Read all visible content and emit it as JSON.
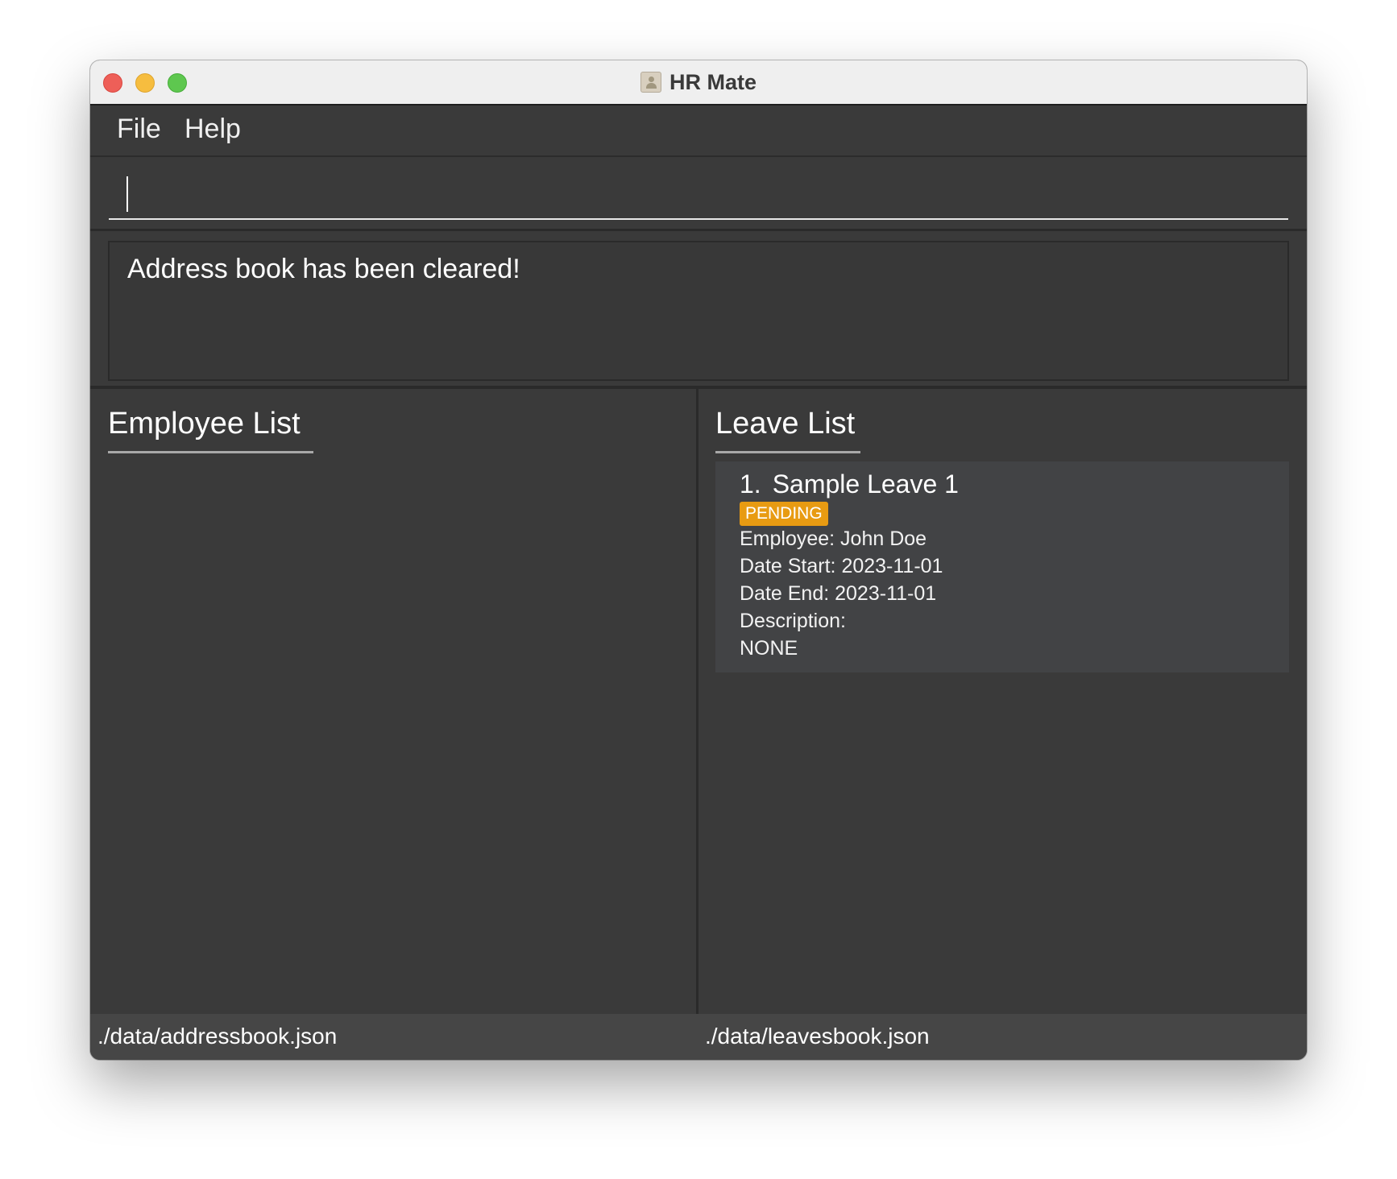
{
  "window": {
    "title": "HR Mate"
  },
  "menu": {
    "file": "File",
    "help": "Help"
  },
  "command": {
    "value": "",
    "placeholder": ""
  },
  "result": {
    "message": "Address book has been cleared!"
  },
  "employee_list": {
    "title": "Employee List",
    "items": []
  },
  "leave_list": {
    "title": "Leave List",
    "items": [
      {
        "index": "1.",
        "title": "Sample Leave 1",
        "status": "PENDING",
        "employee": "Employee: John Doe",
        "date_start": "Date Start: 2023-11-01",
        "date_end": "Date End: 2023-11-01",
        "description_label": "Description:",
        "description": "NONE"
      }
    ]
  },
  "status_bar": {
    "address_book_path": "./data/addressbook.json",
    "leaves_book_path": "./data/leavesbook.json"
  },
  "colors": {
    "window_bg": "#3a3a3a",
    "titlebar_bg": "#efefef",
    "card_bg": "#424345",
    "pending_badge": "#e89b12",
    "close_button": "#ee5f58",
    "minimize_button": "#f6bd3f",
    "maximize_button": "#5ec74f"
  }
}
